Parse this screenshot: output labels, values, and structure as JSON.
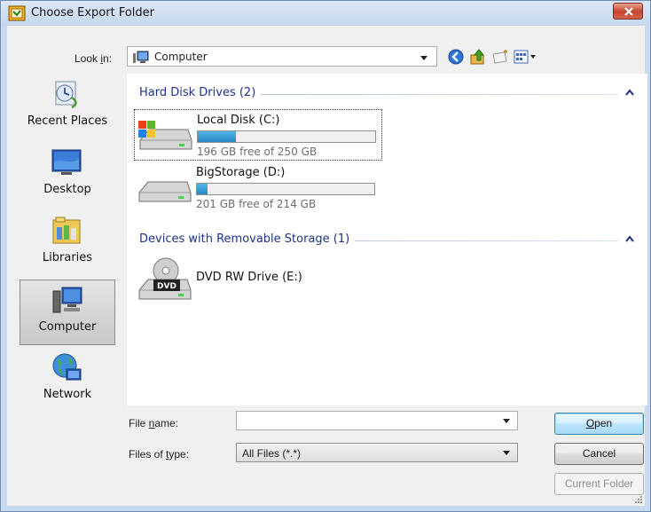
{
  "window": {
    "title": "Choose Export Folder",
    "app_icon": "labview-icon",
    "close_icon": "close-icon",
    "colors": {
      "frame": "#c9d9ee",
      "close": "#c6432c",
      "group_header": "#1e3287",
      "progress": "#2688c4"
    }
  },
  "lookin": {
    "label_prefix": "Look ",
    "label_accel": "i",
    "label_suffix": "n:",
    "value": "Computer",
    "icon": "computer-icon"
  },
  "toolbar": {
    "back_icon": "back-arrow-icon",
    "up_icon": "up-folder-icon",
    "new_folder_icon": "new-folder-icon",
    "views_icon": "views-menu-icon"
  },
  "places": [
    {
      "label": "Recent Places",
      "icon": "recent-places-icon",
      "selected": false
    },
    {
      "label": "Desktop",
      "icon": "desktop-icon",
      "selected": false
    },
    {
      "label": "Libraries",
      "icon": "libraries-icon",
      "selected": false
    },
    {
      "label": "Computer",
      "icon": "computer-icon",
      "selected": true
    },
    {
      "label": "Network",
      "icon": "network-icon",
      "selected": false
    }
  ],
  "groups": {
    "hdd": {
      "title": "Hard Disk Drives (2)"
    },
    "removable": {
      "title": "Devices with Removable Storage (1)"
    }
  },
  "drives": [
    {
      "name": "Local Disk (C:)",
      "free_text": "196 GB free of 250 GB",
      "used_fraction": 0.216,
      "icon": "windows-drive-icon",
      "focused": true
    },
    {
      "name": "BigStorage (D:)",
      "free_text": "201 GB free of 214 GB",
      "used_fraction": 0.061,
      "icon": "hard-drive-icon",
      "focused": false
    },
    {
      "name": "DVD RW Drive (E:)",
      "icon": "dvd-drive-icon",
      "dvd_badge": "DVD"
    }
  ],
  "filename": {
    "label_prefix": "File ",
    "label_accel": "n",
    "label_suffix": "ame:",
    "value": ""
  },
  "filetype": {
    "label_prefix": "Files of ",
    "label_accel": "t",
    "label_suffix": "ype:",
    "value": "All Files (*.*)"
  },
  "buttons": {
    "open_accel": "O",
    "open_rest": "pen",
    "cancel": "Cancel",
    "current_folder": "Current Folder"
  }
}
